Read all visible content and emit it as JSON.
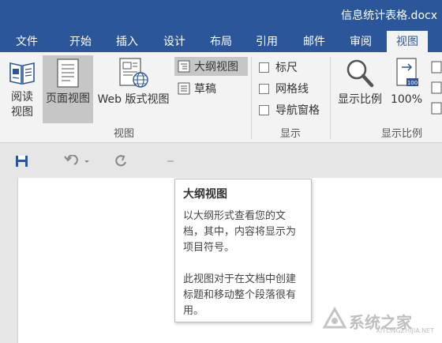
{
  "window": {
    "title": "信息统计表格.docx"
  },
  "tabs": [
    "文件",
    "开始",
    "插入",
    "设计",
    "布局",
    "引用",
    "邮件",
    "审阅",
    "视图"
  ],
  "active_tab": "视图",
  "ribbon": {
    "views": {
      "read_mode": {
        "line1": "阅读",
        "line2": "视图"
      },
      "print_layout": "页面视图",
      "web_layout": "Web 版式视图",
      "outline": "大纲视图",
      "draft": "草稿",
      "group_label": "视图"
    },
    "show": {
      "ruler": "标尺",
      "gridlines": "网格线",
      "nav_pane": "导航窗格",
      "group_label": "显示"
    },
    "zoom": {
      "zoom": "显示比例",
      "percent": "100%",
      "group_label": "显示比例"
    }
  },
  "tooltip": {
    "title": "大纲视图",
    "p1": "以大纲形式查看您的文档，其中，内容将显示为项目符号。",
    "p2": "此视图对于在文档中创建标题和移动整个段落很有用。"
  },
  "watermark": {
    "text": "系统之家",
    "url": "XITONGZHIJIA.NET"
  },
  "colors": {
    "accent": "#2b579a",
    "ribbon_bg": "#f3f3f3",
    "selected": "#c6c6c6",
    "save_icon": "#2b579a"
  }
}
